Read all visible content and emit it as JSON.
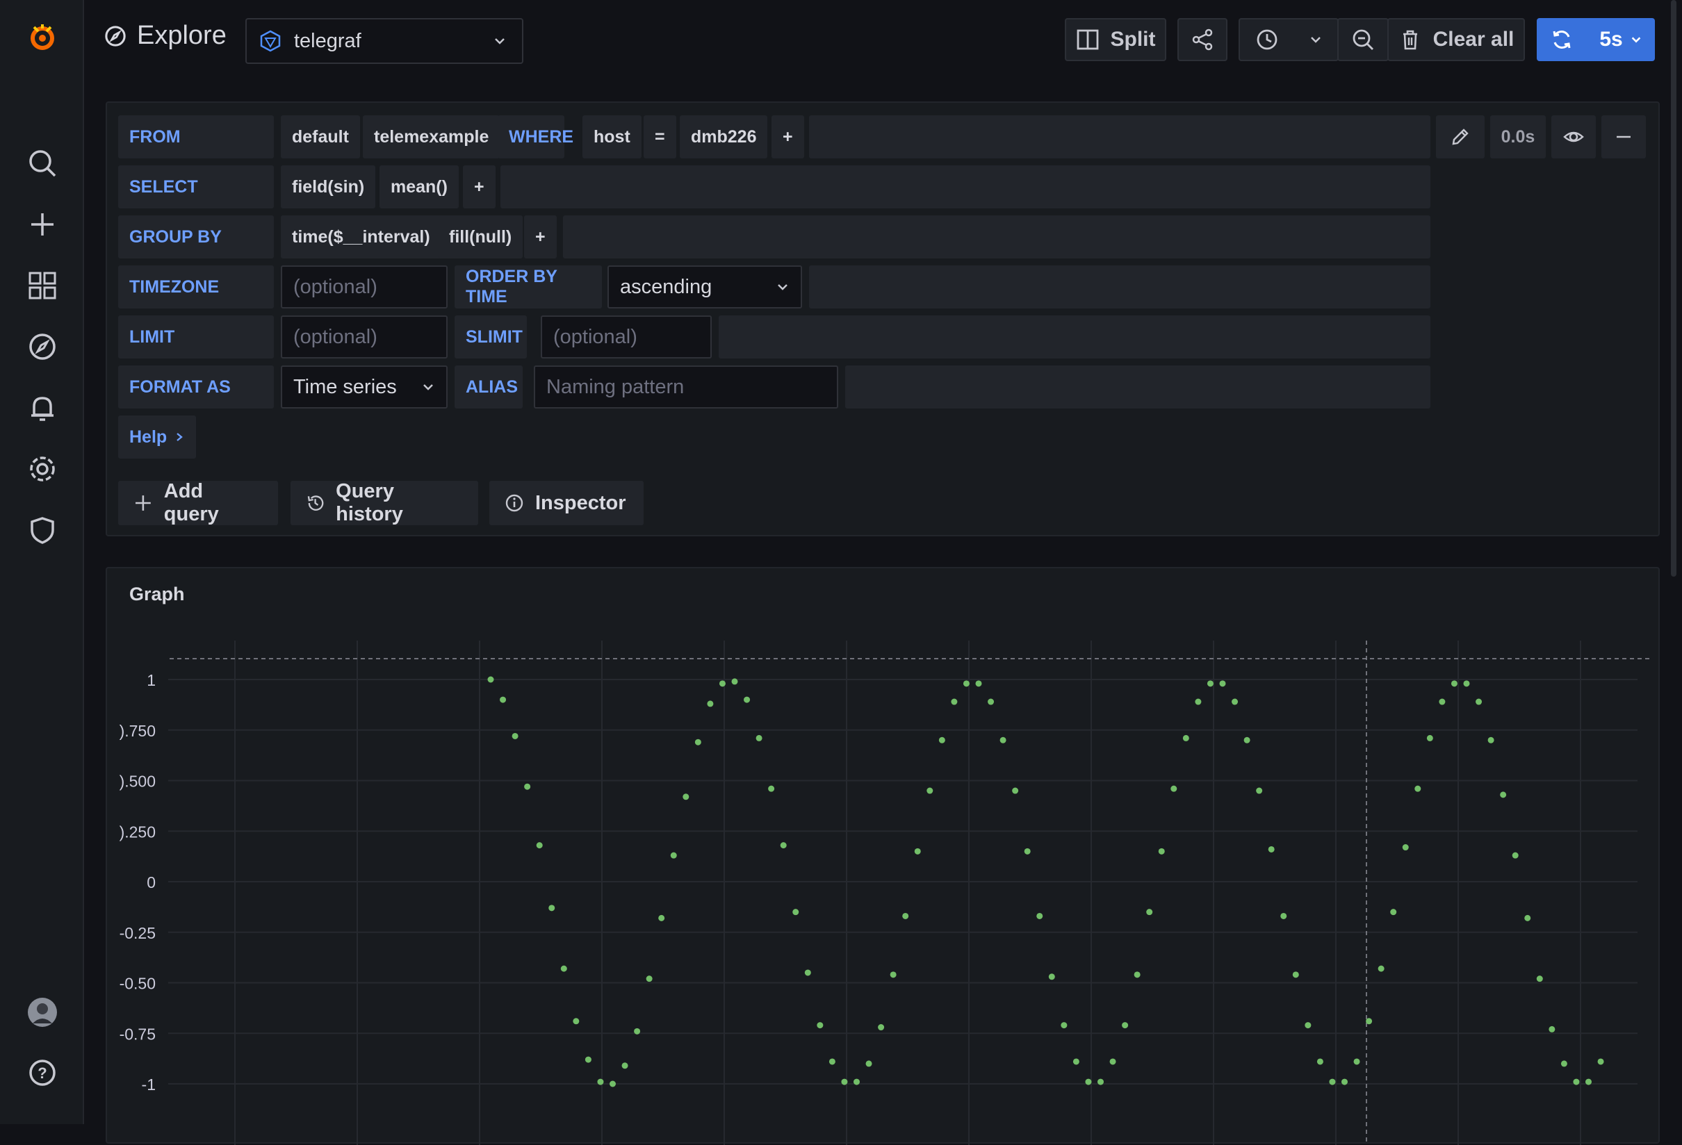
{
  "header": {
    "title": "Explore",
    "datasource": "telegraf",
    "split_label": "Split",
    "clear_label": "Clear all",
    "refresh_interval": "5s"
  },
  "query": {
    "from_label": "FROM",
    "policy": "default",
    "measurement": "telemexample",
    "where_label": "WHERE",
    "where_key": "host",
    "where_op": "=",
    "where_value": "dmb226",
    "plus": "+",
    "query_time": "0.0s",
    "select_label": "SELECT",
    "select_field": "field(sin)",
    "select_fn": "mean()",
    "groupby_label": "GROUP BY",
    "groupby_time": "time($__interval)",
    "groupby_fill": "fill(null)",
    "timezone_label": "TIMEZONE",
    "timezone_placeholder": "(optional)",
    "orderby_label": "ORDER BY TIME",
    "orderby_value": "ascending",
    "limit_label": "LIMIT",
    "limit_placeholder": "(optional)",
    "slimit_label": "SLIMIT",
    "slimit_placeholder": "(optional)",
    "format_label": "FORMAT AS",
    "format_value": "Time series",
    "alias_label": "ALIAS",
    "alias_placeholder": "Naming pattern",
    "help_label": "Help"
  },
  "actions": {
    "add_query": "Add query",
    "query_history": "Query history",
    "inspector": "Inspector"
  },
  "colors": {
    "accent": "#3871dc",
    "keyword": "#6e9fff",
    "series": "#73bf69",
    "logo": "#f46800"
  },
  "panel": {
    "title": "Graph"
  },
  "chart_data": {
    "type": "scatter",
    "title": "Graph",
    "ylim": [
      -1,
      1
    ],
    "y_ticks": [
      "1",
      ").750",
      ").500",
      ").250",
      "0",
      "-0.25",
      "-0.50",
      "-0.75",
      "-1"
    ],
    "grid": true,
    "y_values": [
      1.0,
      0.9,
      0.72,
      0.47,
      0.18,
      -0.13,
      -0.43,
      -0.69,
      -0.88,
      -0.99,
      -1.0,
      -0.91,
      -0.74,
      -0.48,
      -0.18,
      0.13,
      0.42,
      0.69,
      0.88,
      0.98,
      0.99,
      0.9,
      0.71,
      0.46,
      0.18,
      -0.15,
      -0.45,
      -0.71,
      -0.89,
      -0.99,
      -0.99,
      -0.9,
      -0.72,
      -0.46,
      -0.17,
      0.15,
      0.45,
      0.7,
      0.89,
      0.98,
      0.98,
      0.89,
      0.7,
      0.45,
      0.15,
      -0.17,
      -0.47,
      -0.71,
      -0.89,
      -0.99,
      -0.99,
      -0.89,
      -0.71,
      -0.46,
      -0.15,
      0.15,
      0.46,
      0.71,
      0.89,
      0.98,
      0.98,
      0.89,
      0.7,
      0.45,
      0.16,
      -0.17,
      -0.46,
      -0.71,
      -0.89,
      -0.99,
      -0.99,
      -0.89,
      -0.69,
      -0.43,
      -0.15,
      0.17,
      0.46,
      0.71,
      0.89,
      0.98,
      0.98,
      0.89,
      0.7,
      0.43,
      0.13,
      -0.18,
      -0.48,
      -0.73,
      -0.9,
      -0.99,
      -0.99,
      -0.89
    ]
  }
}
